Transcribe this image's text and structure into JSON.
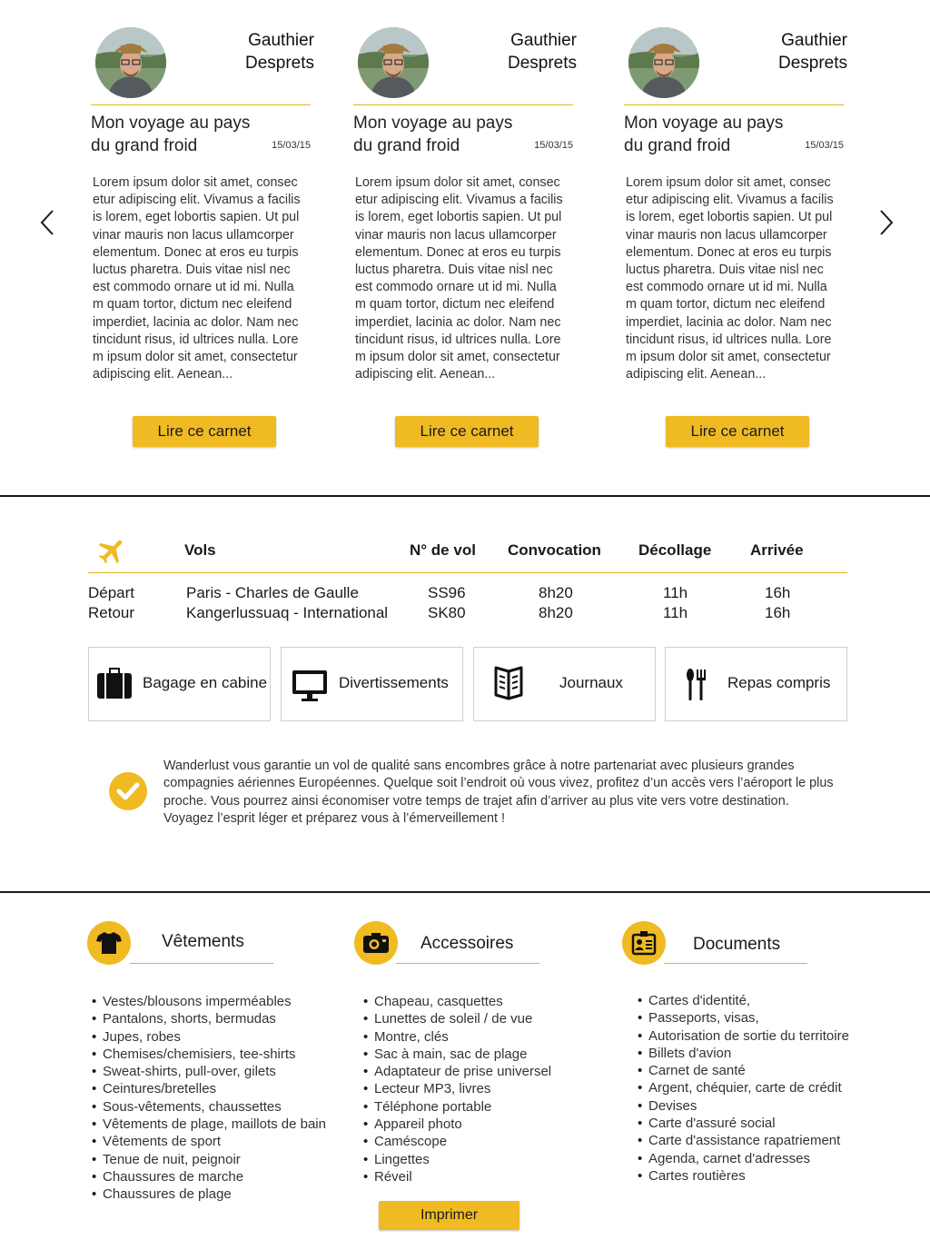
{
  "cards": [
    {
      "author_first": "Gauthier",
      "author_last": "Desprets",
      "title": "Mon voyage au pays du grand froid",
      "date": "15/03/15",
      "body": "Lorem ipsum dolor sit amet, consec\netur adipiscing elit. Vivamus a facilis\nis lorem, eget lobortis sapien. Ut pul\nvinar mauris non lacus ullamcorper\nelementum. Donec at eros eu turpis\n luctus pharetra. Duis vitae nisl nec\nest commodo ornare ut id mi. Nulla\nm quam tortor, dictum nec eleifend\nimperdiet, lacinia ac dolor. Nam nec\ntincidunt risus, id ultrices nulla. Lore\nm ipsum dolor sit amet, consectetur\nadipiscing elit. Aenean...",
      "button": "Lire ce carnet"
    },
    {
      "author_first": "Gauthier",
      "author_last": "Desprets",
      "title": "Mon voyage au pays du grand froid",
      "date": "15/03/15",
      "body": "Lorem ipsum dolor sit amet, consec\netur adipiscing elit. Vivamus a facilis\nis lorem, eget lobortis sapien. Ut pul\nvinar mauris non lacus ullamcorper\nelementum. Donec at eros eu turpis\n luctus pharetra. Duis vitae nisl nec\nest commodo ornare ut id mi. Nulla\nm quam tortor, dictum nec eleifend\nimperdiet, lacinia ac dolor. Nam nec\ntincidunt risus, id ultrices nulla. Lore\nm ipsum dolor sit amet, consectetur\nadipiscing elit. Aenean...",
      "button": "Lire ce carnet"
    },
    {
      "author_first": "Gauthier",
      "author_last": "Desprets",
      "title": "Mon voyage au pays du grand froid",
      "date": "15/03/15",
      "body": "Lorem ipsum dolor sit amet, consec\netur adipiscing elit. Vivamus a facilis\nis lorem, eget lobortis sapien. Ut pul\nvinar mauris non lacus ullamcorper\nelementum. Donec at eros eu turpis\n luctus pharetra. Duis vitae nisl nec\nest commodo ornare ut id mi. Nulla\nm quam tortor, dictum nec eleifend\nimperdiet, lacinia ac dolor. Nam nec\ntincidunt risus, id ultrices nulla. Lore\nm ipsum dolor sit amet, consectetur\nadipiscing elit. Aenean...",
      "button": "Lire ce carnet"
    }
  ],
  "flights": {
    "headers": {
      "vols": "Vols",
      "numero": "N° de vol",
      "convocation": "Convocation",
      "decollage": "Décollage",
      "arrivee": "Arrivée"
    },
    "rows": [
      {
        "type": "Départ",
        "route": "Paris - Charles de Gaulle",
        "numero": "SS96",
        "convocation": "8h20",
        "decollage": "11h",
        "arrivee": "16h"
      },
      {
        "type": "Retour",
        "route": "Kangerlussuaq - International",
        "numero": "SK80",
        "convocation": "8h20",
        "decollage": "11h",
        "arrivee": "16h"
      }
    ],
    "amenities": [
      "Bagage en cabine",
      "Divertissements",
      "Journaux",
      "Repas compris"
    ],
    "guarantee": "Wanderlust vous garantie un  vol de qualité sans encombres grâce à notre partenariat avec plusieurs grandes compagnies aériennes Européennes. Quelque soit l’endroit où  vous vivez, profitez d’un accès vers l’aéroport le plus proche. Vous pourrez ainsi économiser votre temps de trajet afin d’arriver au plus vite vers votre destination. Voyagez l’esprit léger et préparez vous à l’émerveillement !"
  },
  "checklist": {
    "vetements": {
      "title": "Vêtements",
      "items": [
        "Vestes/blousons imperméables",
        "Pantalons, shorts, bermudas",
        "Jupes, robes",
        "Chemises/chemisiers, tee-shirts",
        "Sweat-shirts, pull-over, gilets",
        "Ceintures/bretelles",
        "Sous-vêtements, chaussettes",
        "Vêtements de plage, maillots de bain",
        "Vêtements de sport",
        "Tenue de nuit, peignoir",
        "Chaussures de marche",
        "Chaussures de plage"
      ]
    },
    "accessoires": {
      "title": "Accessoires",
      "items": [
        "Chapeau, casquettes",
        "Lunettes de soleil / de vue",
        "Montre, clés",
        "Sac à main, sac de plage",
        "Adaptateur de prise universel",
        "Lecteur MP3, livres",
        "Téléphone portable",
        "Appareil photo",
        "Caméscope",
        "Lingettes",
        "Réveil"
      ]
    },
    "documents": {
      "title": "Documents",
      "items": [
        "Cartes d'identité,",
        "Passeports, visas,",
        "Autorisation de sortie du territoire",
        "Billets d'avion",
        "Carnet de santé",
        "Argent, chéquier, carte de crédit",
        "Devises",
        "Carte d'assuré social",
        "Carte d'assistance rapatriement",
        "Agenda, carnet d'adresses",
        "Cartes routières"
      ]
    },
    "print_button": "Imprimer"
  },
  "colors": {
    "accent": "#f0ba22",
    "rule": "#e3b11f",
    "text": "#1a1a1a"
  }
}
